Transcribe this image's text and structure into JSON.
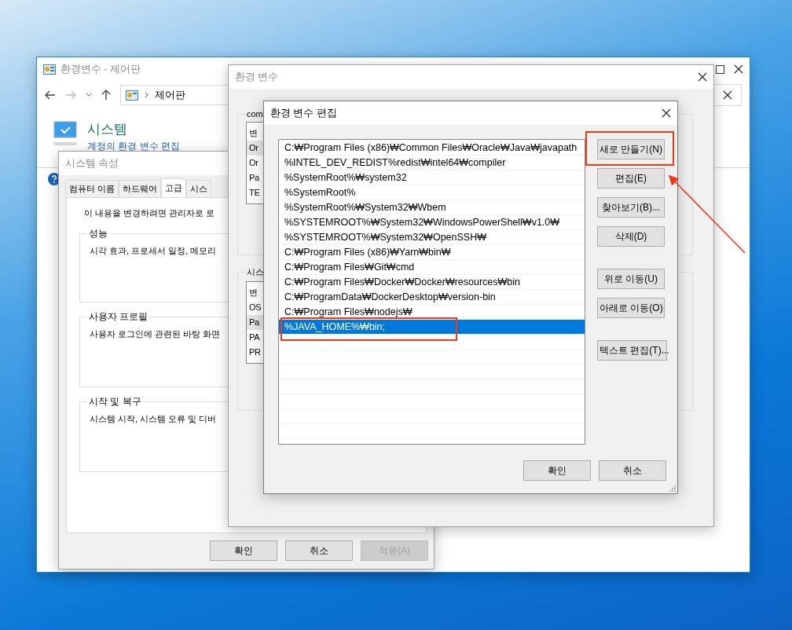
{
  "control_panel": {
    "title": "환경변수 - 제어판",
    "address": "제어판",
    "heading": "시스템",
    "link": "계정의 환경 변수 편집"
  },
  "system_properties": {
    "title": "시스템 속성",
    "tabs": [
      {
        "label": "컴퓨터 이름",
        "selected": false
      },
      {
        "label": "하드웨어",
        "selected": false
      },
      {
        "label": "고급",
        "selected": true
      },
      {
        "label": "시스",
        "selected": false
      }
    ],
    "notice": "이 내용을 변경하려면 관리자로 로",
    "groups": [
      {
        "title": "성능",
        "text": "시각 효과, 프로세서 일정, 메모리"
      },
      {
        "title": "사용자 프로필",
        "text": "사용자 로그인에 관련된 바탕 화면"
      },
      {
        "title": "시작 및 복구",
        "text": "시스템 시작, 시스템 오류 및 디버"
      }
    ],
    "buttons": [
      {
        "label": "확인",
        "disabled": false
      },
      {
        "label": "취소",
        "disabled": false
      },
      {
        "label": "적용(A)",
        "disabled": true
      }
    ]
  },
  "environment_variables": {
    "title": "환경 변수",
    "groups": [
      {
        "title": "com",
        "header": "변",
        "rows": [
          {
            "text": "Or",
            "selected": true
          },
          {
            "text": "Or",
            "selected": false
          },
          {
            "text": "Pa",
            "selected": false
          },
          {
            "text": "TE",
            "selected": false
          }
        ]
      },
      {
        "title": "시스",
        "header": "변",
        "rows": [
          {
            "text": "OS",
            "selected": false
          },
          {
            "text": "Pa",
            "selected": true
          },
          {
            "text": "PA",
            "selected": false
          },
          {
            "text": "PR",
            "selected": false
          }
        ]
      }
    ]
  },
  "edit_dialog": {
    "title": "환경 변수 편집",
    "entries": [
      {
        "text": "C:₩Program Files (x86)₩Common Files₩Oracle₩Java₩javapath",
        "selected": false
      },
      {
        "text": "%INTEL_DEV_REDIST%redist₩intel64₩compiler",
        "selected": false
      },
      {
        "text": "%SystemRoot%₩system32",
        "selected": false
      },
      {
        "text": "%SystemRoot%",
        "selected": false
      },
      {
        "text": "%SystemRoot%₩System32₩Wbem",
        "selected": false
      },
      {
        "text": "%SYSTEMROOT%₩System32₩WindowsPowerShell₩v1.0₩",
        "selected": false
      },
      {
        "text": "%SYSTEMROOT%₩System32₩OpenSSH₩",
        "selected": false
      },
      {
        "text": "C:₩Program Files (x86)₩Yarn₩bin₩",
        "selected": false
      },
      {
        "text": "C:₩Program Files₩Git₩cmd",
        "selected": false
      },
      {
        "text": "C:₩Program Files₩Docker₩Docker₩resources₩bin",
        "selected": false
      },
      {
        "text": "C:₩ProgramData₩DockerDesktop₩version-bin",
        "selected": false
      },
      {
        "text": "C:₩Program Files₩nodejs₩",
        "selected": false
      },
      {
        "text": "%JAVA_HOME%₩bin;",
        "selected": true
      }
    ],
    "side_buttons": [
      [
        "새로 만들기(N)",
        "편집(E)",
        "찾아보기(B)...",
        "삭제(D)"
      ],
      [
        "위로 이동(U)",
        "아래로 이동(O)"
      ],
      [
        "텍스트 편집(T)..."
      ]
    ],
    "buttons": [
      "확인",
      "취소"
    ]
  }
}
